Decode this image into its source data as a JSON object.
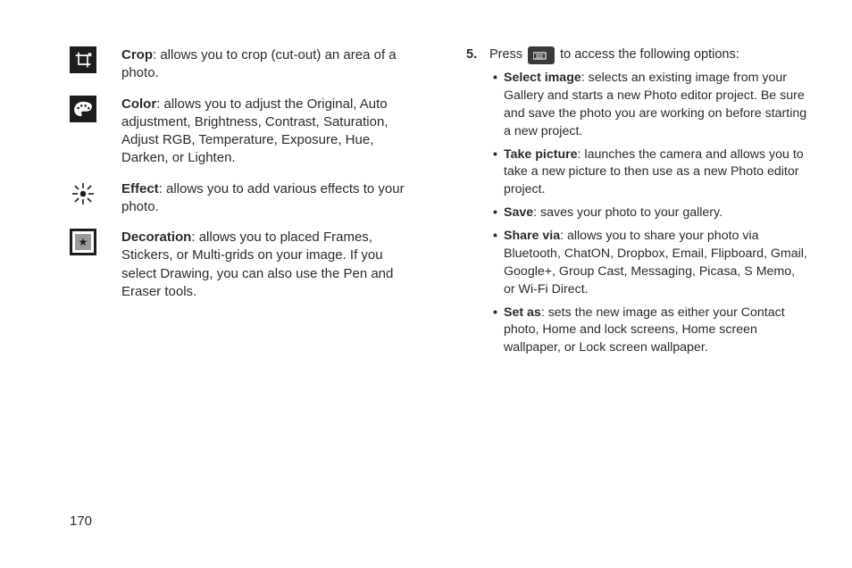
{
  "page_number": "170",
  "left": {
    "items": [
      {
        "title": "Crop",
        "text": ": allows you to crop (cut-out) an area of a photo."
      },
      {
        "title": "Color",
        "text": ": allows you to adjust the Original, Auto adjustment, Brightness, Contrast, Saturation, Adjust RGB, Temperature, Exposure, Hue, Darken, or Lighten."
      },
      {
        "title": "Effect",
        "text": ": allows you to add various effects to your photo."
      },
      {
        "title": "Decoration",
        "text": ": allows you to placed Frames, Stickers, or Multi-grids on your image. If you select Drawing, you can also use the Pen and Eraser tools."
      }
    ]
  },
  "right": {
    "step_num": "5.",
    "press": "Press",
    "press_tail": "to access the following options:",
    "options": [
      {
        "title": "Select image",
        "text": ": selects an existing image from your Gallery and starts a new Photo editor project. Be sure and save the photo you are working on before starting a new project."
      },
      {
        "title": "Take picture",
        "text": ": launches the camera and allows you to take a new picture to then use as a new Photo editor project."
      },
      {
        "title": "Save",
        "text": ": saves your photo to your gallery."
      },
      {
        "title": "Share via",
        "text": ": allows you to share your photo via Bluetooth, ChatON, Dropbox, Email, Flipboard, Gmail, Google+, Group Cast, Messaging, Picasa, S Memo, or Wi-Fi Direct."
      },
      {
        "title": "Set as",
        "text": ": sets the new image as either your Contact photo, Home and lock screens, Home screen wallpaper, or Lock screen wallpaper."
      }
    ]
  }
}
